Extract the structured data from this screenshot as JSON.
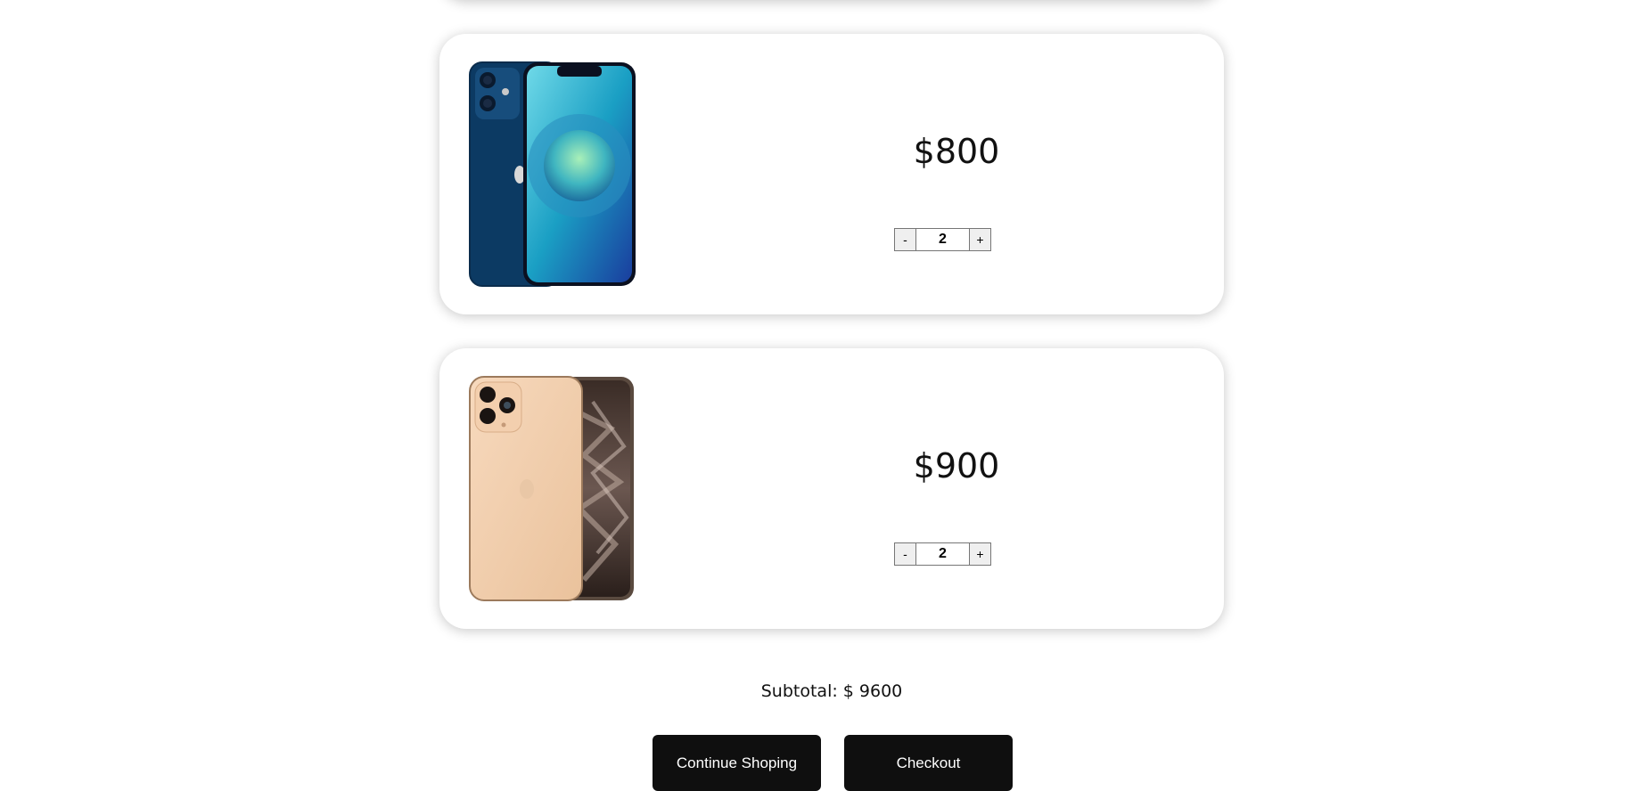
{
  "cart": {
    "items": [
      {
        "image_name": "iphone-12-blue",
        "price": "$800",
        "quantity": "2",
        "decrement_label": "-",
        "increment_label": "+"
      },
      {
        "image_name": "iphone-11-pro-gold",
        "price": "$900",
        "quantity": "2",
        "decrement_label": "-",
        "increment_label": "+"
      }
    ],
    "subtotal_label": "Subtotal: $ 9600"
  },
  "actions": {
    "continue_label": "Continue Shoping",
    "checkout_label": "Checkout"
  },
  "colors": {
    "button_bg": "#0f0f0f",
    "button_text": "#ffffff",
    "page_bg": "#ffffff"
  }
}
